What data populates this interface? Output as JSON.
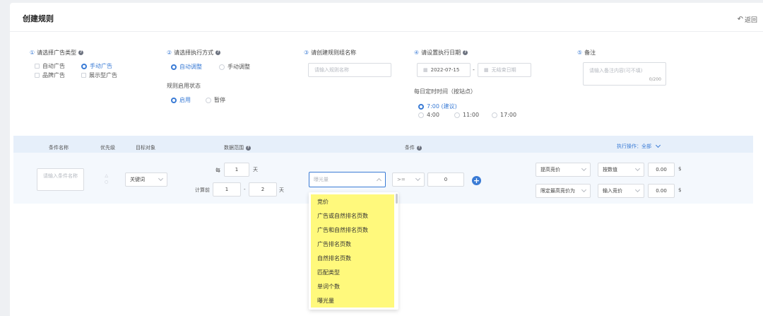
{
  "header": {
    "title": "创建规则",
    "back_label": "返回"
  },
  "sections": {
    "ad_type": {
      "num": "①",
      "title": "请选择广告类型",
      "options": [
        "自动广告",
        "手动广告",
        "品牌广告",
        "展示型广告"
      ]
    },
    "exec_mode": {
      "num": "②",
      "title": "请选择执行方式",
      "options": [
        "自动调整",
        "手动调整"
      ],
      "status_title": "规则启用状态",
      "status_options": [
        "启用",
        "暂停"
      ]
    },
    "group_name": {
      "num": "③",
      "title": "请创建规则组名称",
      "placeholder": "请输入规则名称"
    },
    "exec_date": {
      "num": "④",
      "title": "请设置执行日期",
      "start_date": "2022-07-15",
      "end_placeholder": "无结束日期",
      "dash": "-",
      "time_title": "每日定时时间（按站点）",
      "times": [
        "7:00 (建议)",
        "4:00",
        "11:00",
        "17:00"
      ]
    },
    "remark": {
      "num": "⑤",
      "title": "备注",
      "placeholder": "请输入备注内容(可不填)",
      "counter": "0/200"
    }
  },
  "table": {
    "headers": {
      "cond_name": "条件名称",
      "priority": "优先级",
      "target": "目标对象",
      "data_range": "数据范围",
      "condition": "条件",
      "action": "执行操作：全部"
    },
    "row": {
      "name_placeholder": "请输入条件名称",
      "target": "关键词",
      "every_label": "每",
      "every_value": "1",
      "day_label": "天",
      "calc_label": "计算前",
      "calc_from": "1",
      "calc_dash": "-",
      "calc_to": "2",
      "calc_day": "天",
      "metric_placeholder": "曝光量",
      "operator": ">=",
      "threshold": "0",
      "actions": [
        {
          "action": "提高竞价",
          "mode": "按数值",
          "value": "0.00",
          "unit": "$"
        },
        {
          "action": "限定最高竞价为",
          "mode": "输入竞价",
          "value": "0.00",
          "unit": "$"
        }
      ]
    }
  },
  "dropdown": {
    "items": [
      "竞价",
      "广告或自然排名页数",
      "广告和自然排名页数",
      "广告排名页数",
      "自然排名页数",
      "匹配类型",
      "单词个数",
      "曝光量"
    ]
  },
  "colors": {
    "accent": "#3a7bd5",
    "highlight": "#fff97c"
  }
}
